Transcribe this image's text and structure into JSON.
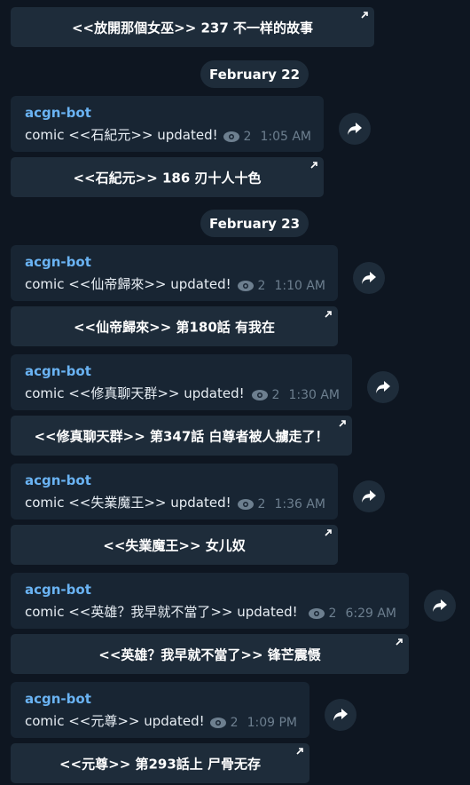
{
  "messages": [
    {
      "button_label": "<<放開那個女巫>> 237 不一样的故事"
    },
    {
      "date": "February 22"
    },
    {
      "sender": "acgn-bot",
      "text": "comic <<石紀元>> updated!",
      "views": "2",
      "time": "1:05 AM",
      "button_label": "<<石紀元>> 186 刃十人十色"
    },
    {
      "date": "February 23"
    },
    {
      "sender": "acgn-bot",
      "text": "comic <<仙帝歸來>> updated!",
      "views": "2",
      "time": "1:10 AM",
      "button_label": "<<仙帝歸來>> 第180話 有我在"
    },
    {
      "sender": "acgn-bot",
      "text": "comic <<修真聊天群>> updated!",
      "views": "2",
      "time": "1:30 AM",
      "button_label": "<<修真聊天群>> 第347話 白尊者被人擄走了！"
    },
    {
      "sender": "acgn-bot",
      "text": "comic <<失業魔王>> updated!",
      "views": "2",
      "time": "1:36 AM",
      "button_label": "<<失業魔王>> 女儿奴"
    },
    {
      "sender": "acgn-bot",
      "text": "comic <<英雄？我早就不當了>> updated!",
      "views": "2",
      "time": "6:29 AM",
      "button_label": "<<英雄？我早就不當了>> 锋芒震慑"
    },
    {
      "sender": "acgn-bot",
      "text": "comic <<元尊>> updated!",
      "views": "2",
      "time": "1:09 PM",
      "button_label": "<<元尊>> 第293話上 尸骨无存"
    }
  ],
  "icons": {
    "views": "eye-icon",
    "share": "share-forward-icon",
    "button_link": "arrow-up-right-icon"
  },
  "colors": {
    "background": "#0e1621",
    "bubble": "#182533",
    "sender": "#6ab3f3",
    "button": "#1e2c3a"
  }
}
